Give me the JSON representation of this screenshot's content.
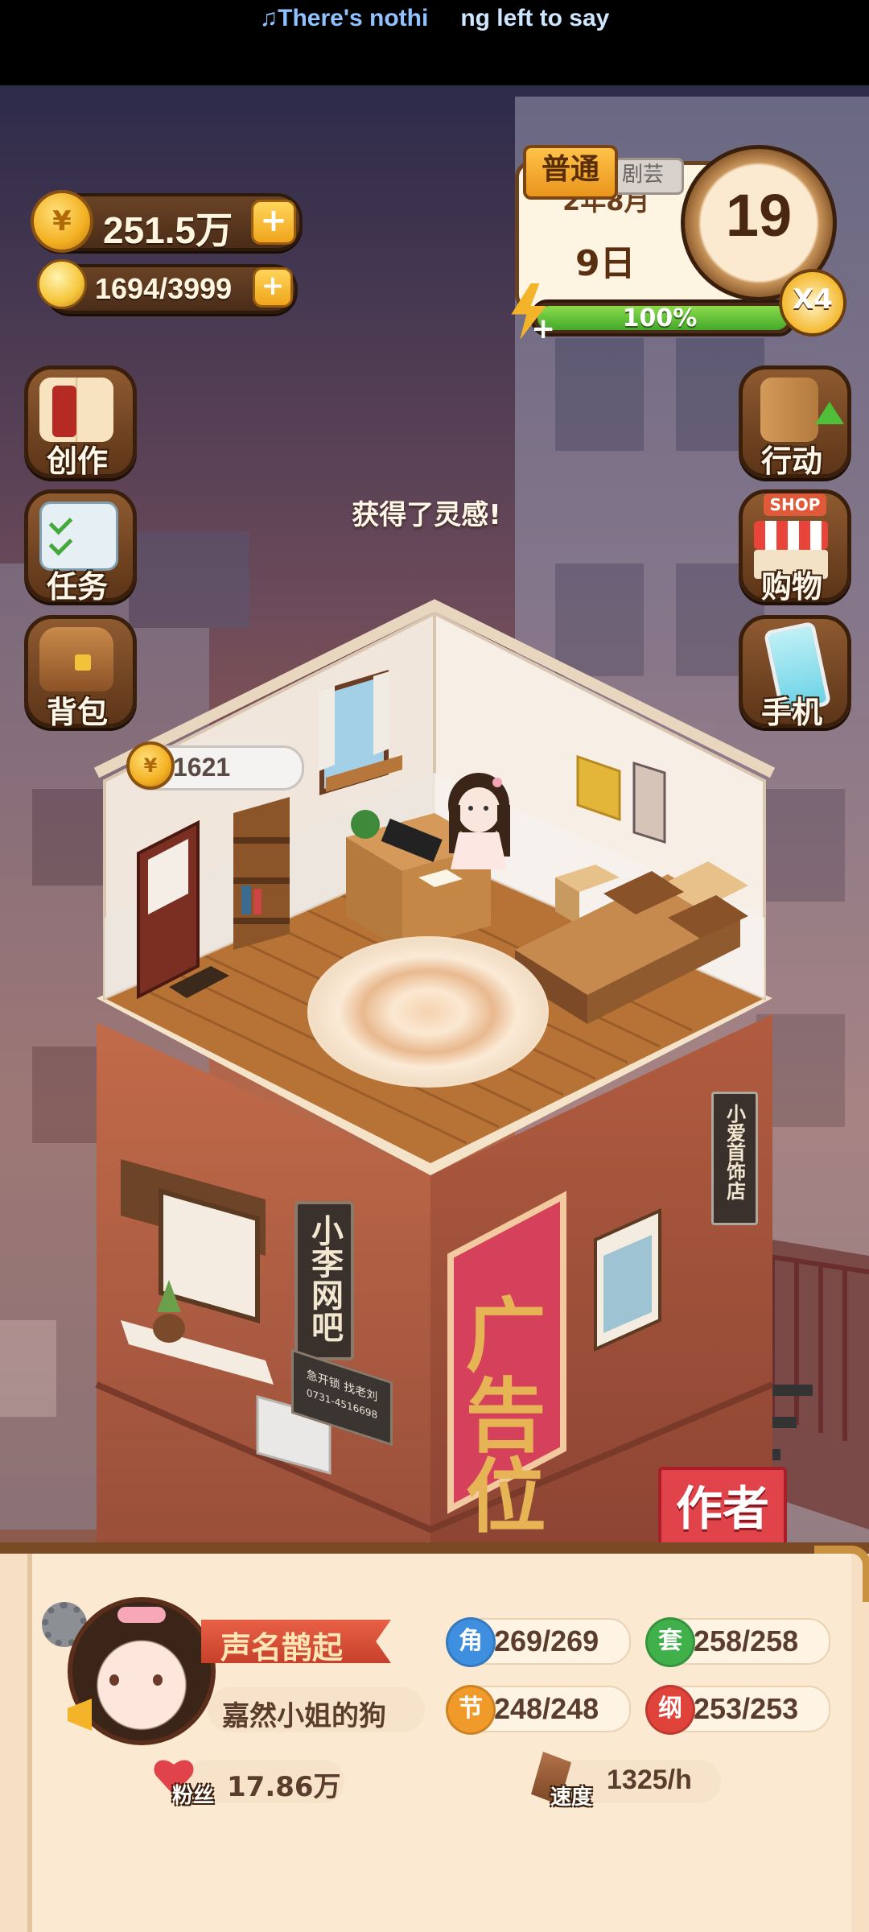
{
  "status_bar": {
    "lyric_part1": "♫There's nothi",
    "lyric_part2": "ng left to say"
  },
  "resources": {
    "coins": "251.5万",
    "inspiration": "1694/3999"
  },
  "calendar": {
    "mode": "普通",
    "month": "2年8月",
    "day": "9日",
    "hour": "19",
    "speed": "X4",
    "energy": "100%",
    "energy_fraction": 1.0,
    "hidden_tab": "剧芸"
  },
  "left_menu": [
    {
      "label": "创作",
      "icon": "book-icon"
    },
    {
      "label": "任务",
      "icon": "checklist-icon"
    },
    {
      "label": "背包",
      "icon": "bag-icon"
    }
  ],
  "right_menu": [
    {
      "label": "行动",
      "icon": "door-icon"
    },
    {
      "label": "购物",
      "icon": "shop-icon",
      "badge": "SHOP"
    },
    {
      "label": "手机",
      "icon": "phone-icon"
    }
  ],
  "scene": {
    "toast": "获得了灵感!",
    "coin_bubble": "1621",
    "sign_internet_cafe": "小李网吧",
    "sign_phone_text": "急开锁 找老刘",
    "sign_phone_number": "0731-4516698",
    "sign_side_shop": "小爱首饰店",
    "billboard": "广告位",
    "author_button": "作者"
  },
  "profile": {
    "title": "声名鹊起",
    "name": "嘉然小姐的狗",
    "fans_label": "粉丝",
    "fans": "17.86万",
    "speed_label": "速度",
    "speed": "1325/h",
    "stats": [
      {
        "key": "角",
        "value": "269/269",
        "color": "#3f8fe0"
      },
      {
        "key": "套",
        "value": "258/258",
        "color": "#3fb04a"
      },
      {
        "key": "节",
        "value": "248/248",
        "color": "#f09a2a"
      },
      {
        "key": "纲",
        "value": "253/253",
        "color": "#e0433a"
      }
    ]
  },
  "colors": {
    "sky_top": "#2e2a44",
    "sky_bottom": "#c06a46",
    "panel": "#fbe9d2",
    "wood": "#6a4325"
  }
}
